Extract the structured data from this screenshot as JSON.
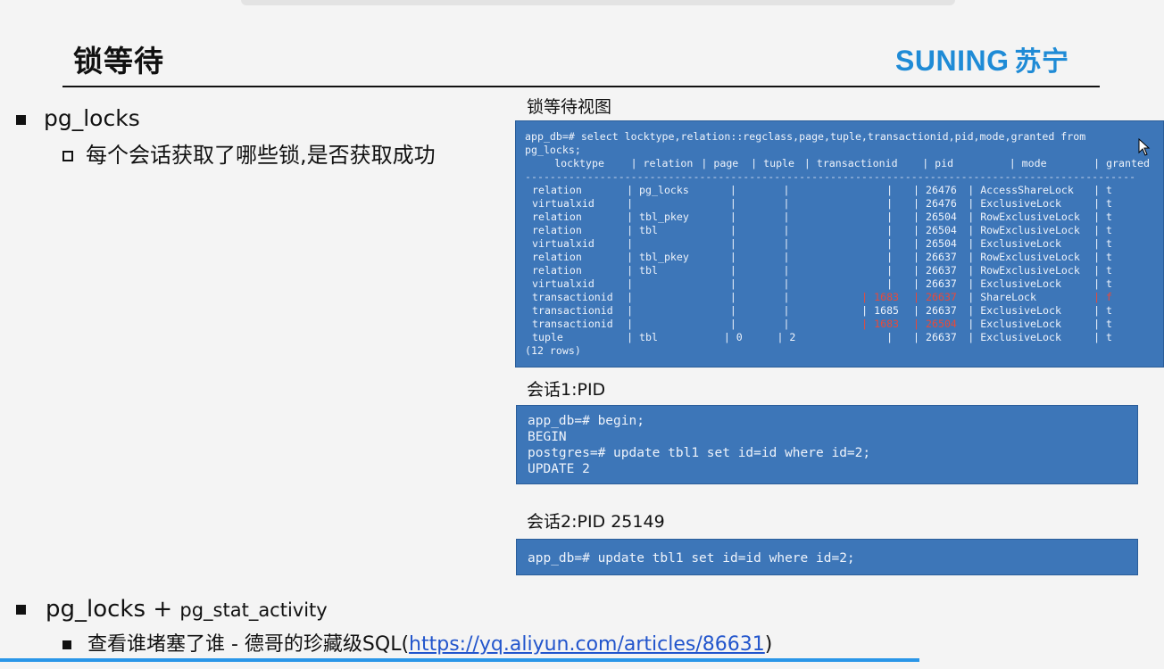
{
  "title": "锁等待",
  "logo": {
    "latin": "SUNING",
    "chinese": "苏宁",
    "color": "#1f8bd6"
  },
  "bullets": {
    "b1": "pg_locks",
    "b1_sub": "每个会话获取了哪些锁,是否获取成功",
    "b2_main": "pg_locks",
    "b2_plus": "+",
    "b2_small": "pg_stat_activity",
    "b2_sub_text": "查看谁堵塞了谁 - 德哥的珍藏级SQL(",
    "b2_sub_link": "https://yq.aliyun.com/articles/86631",
    "b2_sub_close": ")"
  },
  "captions": {
    "locks_view": "锁等待视图",
    "session1": "会话1:PID",
    "session2": "会话2:PID 25149"
  },
  "locks_panel": {
    "query_line1": "app_db=# select locktype,relation::regclass,page,tuple,transactionid,pid,mode,granted from",
    "query_line2": "pg_locks;",
    "columns": [
      "locktype",
      "relation",
      "page",
      "tuple",
      "transactionid",
      "pid",
      "mode",
      "granted"
    ],
    "rows": [
      [
        "relation",
        "pg_locks",
        "",
        "",
        "",
        "26476",
        "AccessShareLock",
        "t"
      ],
      [
        "virtualxid",
        "",
        "",
        "",
        "",
        "26476",
        "ExclusiveLock",
        "t"
      ],
      [
        "relation",
        "tbl_pkey",
        "",
        "",
        "",
        "26504",
        "RowExclusiveLock",
        "t"
      ],
      [
        "relation",
        "tbl",
        "",
        "",
        "",
        "26504",
        "RowExclusiveLock",
        "t"
      ],
      [
        "virtualxid",
        "",
        "",
        "",
        "",
        "26504",
        "ExclusiveLock",
        "t"
      ],
      [
        "relation",
        "tbl_pkey",
        "",
        "",
        "",
        "26637",
        "RowExclusiveLock",
        "t"
      ],
      [
        "relation",
        "tbl",
        "",
        "",
        "",
        "26637",
        "RowExclusiveLock",
        "t"
      ],
      [
        "virtualxid",
        "",
        "",
        "",
        "",
        "26637",
        "ExclusiveLock",
        "t"
      ],
      [
        "transactionid",
        "",
        "",
        "",
        "1683",
        "26637",
        "ShareLock",
        "f"
      ],
      [
        "transactionid",
        "",
        "",
        "",
        "1685",
        "26637",
        "ExclusiveLock",
        "t"
      ],
      [
        "transactionid",
        "",
        "",
        "",
        "1683",
        "26504",
        "ExclusiveLock",
        "t"
      ],
      [
        "tuple",
        "tbl",
        "0",
        "2",
        "",
        "26637",
        "ExclusiveLock",
        "t"
      ]
    ],
    "highlight_color": "#e84a3a",
    "footer": "(12 rows)"
  },
  "session1_panel": {
    "lines": [
      "app_db=# begin;",
      "BEGIN",
      "postgres=# update tbl1 set id=id where id=2;",
      "UPDATE 2"
    ]
  },
  "session2_panel": {
    "lines": [
      "app_db=# update tbl1 set id=id where id=2;"
    ]
  },
  "colors": {
    "panel_bg": "#3d76b8",
    "accent_line": "#2a96e8",
    "link": "#2255cc"
  }
}
